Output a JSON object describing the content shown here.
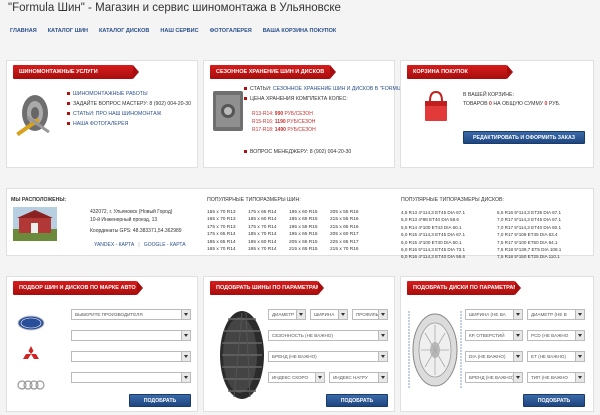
{
  "header": {
    "title": "\"Formula Шин\" - Магазин и сервис шиномонтажа в Ульяновске"
  },
  "nav": {
    "items": [
      "ГЛАВНАЯ",
      "КАТАЛОГ ШИН",
      "КАТАЛОГ ДИСКОВ",
      "НАШ СЕРВИС",
      "ФОТОГАЛЕРЕЯ",
      "ВАША КОРЗИНА ПОКУПОК"
    ]
  },
  "tire_service": {
    "title": "ШИНОМОНТАЖНЫЕ УСЛУГИ",
    "items": [
      "ШИНОМОНТАЖНЫЕ РАБОТЫ",
      "ЗАДАЙТЕ ВОПРОС МАСТЕРУ: 8 (902) 004-20-30",
      "СТАТЬИ: ПРО НАШ ШИНОМОНТАЖ",
      "НАША ФОТОГАЛЕРЕЯ"
    ]
  },
  "storage": {
    "title": "СЕЗОННОЕ ХРАНЕНИЕ ШИН И ДИСКОВ",
    "articles_label": "СТАТЬИ:",
    "articles_link": "СЕЗОННОЕ ХРАНЕНИЕ ШИН И ДИСКОВ В \"FORMULA ШИН\"",
    "price_label": "ЦЕНА ХРАНЕНИЯ КОМПЛЕКТА КОЛЕС:",
    "prices": [
      {
        "size": "R13-R14:",
        "price": "990",
        "unit": "РУБ/СЕЗОН"
      },
      {
        "size": "R15-R16:",
        "price": "1190",
        "unit": "РУБ/СЕЗОН"
      },
      {
        "size": "R17-R18:",
        "price": "1490",
        "unit": "РУБ/СЕЗОН"
      }
    ],
    "manager": "ВОПРОС МЕНЕДЖЕРУ: 8 (902) 004-20-30"
  },
  "cart": {
    "title": "КОРЗИНА ПОКУПОК",
    "label": "В ВАШЕЙ КОРЗИНЕ:",
    "prefix": "ТОВАРОВ",
    "count": "0",
    "middle": "НА ОБЩУЮ СУММУ",
    "sum": "0",
    "suffix": "РУБ.",
    "button": "РЕДАКТИРОВАТЬ И ОФОРМИТЬ ЗАКАЗ"
  },
  "location": {
    "label": "МЫ РАСПОЛОЖЕНЫ:",
    "address1": "432072, г. Ульяновск (Новый Город)",
    "address2": "10-й Инженерный проезд, 13",
    "gps": "Координаты GPS: 48.383371,54.362989",
    "yandex": "YANDEX - КАРТА",
    "sep": "|",
    "google": "GOOGLE - КАРТА"
  },
  "popular_tires": {
    "title": "ПОПУЛЯРНЫЕ ТИПОРАЗМЕРЫ ШИН:",
    "rows": [
      [
        "155 x 70 R13",
        "175 x 65 R14",
        "185 x 60 R15",
        "205 x 55 R16"
      ],
      [
        "165 x 70 R13",
        "185 x 60 R14",
        "185 x 65 R15",
        "215 x 55 R16"
      ],
      [
        "175 x 70 R13",
        "175 x 70 R14",
        "195 x 55 R15",
        "215 x 65 R16"
      ],
      [
        "175 x 65 R14",
        "185 x 70 R14",
        "195 x 65 R15",
        "205 x 60 R17"
      ],
      [
        "185 x 65 R14",
        "195 x 60 R14",
        "205 x 65 R15",
        "225 x 65 R17"
      ],
      [
        "165 x 70 R14",
        "195 x 70 R14",
        "215 x 65 R15",
        "215 x 70 R16"
      ]
    ]
  },
  "popular_wheels": {
    "title": "ПОПУЛЯРНЫЕ ТИПОРАЗМЕРЫ ДИСКОВ:",
    "rows": [
      [
        "4,5 R13 4*114,3 ET45 DIA 67.1",
        "6,5 R16 5*114,3 ET35 DIA 67.1"
      ],
      [
        "5,0 R13 4*98 ET40 DIA 58.6",
        "7,0 R17 5*114,3 ET45 DIA 67.1"
      ],
      [
        "5,5 R14 4*100 ET43 DIA 60.1",
        "7,0 R17 5*114,3 ET40 DIA 60.1"
      ],
      [
        "6,0 R15 4*114,3 ET45 DIA 67.1",
        "7,0 R17 5*108 ET45 DIA 63.4"
      ],
      [
        "6,0 R15 4*100 ET40 DIA 60.1",
        "7,5 R17 5*100 ET50 DIA 64.1"
      ],
      [
        "6,0 R16 5*114,3 ET45 DIA 73.1",
        "7,5 R18 5*139,7 ET5 DIA 108.1"
      ],
      [
        "6,0 R16 4*114,3 ET40 DIA 56.6",
        "7,5 R18 5*150 ET25 DIA 110.1"
      ]
    ]
  },
  "by_car": {
    "title": "ПОДБОР ШИН И ДИСКОВ ПО МАРКЕ АВТО",
    "select_placeholder": "ВЫБЕРИТЕ ПРОИЗВОДИТЕЛЯ",
    "button": "ПОДОБРАТЬ",
    "brands": [
      "Ford",
      "Mitsubishi",
      "Audi"
    ]
  },
  "by_tire_params": {
    "title": "ПОДОБРАТЬ ШИНЫ ПО ПАРАМЕТРАМ",
    "width": "ДИАМЕТР",
    "profile": "ШИРИНА",
    "diameter": "ПРОФИЛЬ",
    "season": "СЕЗОННОСТЬ (НЕ ВАЖНО)",
    "brand": "БРЕНД (НЕ ВАЖНО)",
    "speed": "ИНДЕКС СКОРО",
    "load": "ИНДЕКС НАГРУ",
    "button": "ПОДОБРАТЬ"
  },
  "by_wheel_params": {
    "title": "ПОДОБРАТЬ ДИСКИ ПО ПАРАМЕТРАМ",
    "width": "ШИРИНА (НЕ ВА",
    "diameter": "ДИАМЕТР (НЕ В",
    "bolt": "КР. ОТВЕРСТИЙ",
    "pcd": "PCD (НЕ ВАЖНО",
    "dia": "DIA (НЕ ВАЖНО)",
    "et": "ET (НЕ ВАЖНО)",
    "brand": "БРЕНД (НЕ ВАЖНО)",
    "type": "ТИП (НЕ ВАЖНО",
    "button": "ПОДОБРАТЬ"
  }
}
